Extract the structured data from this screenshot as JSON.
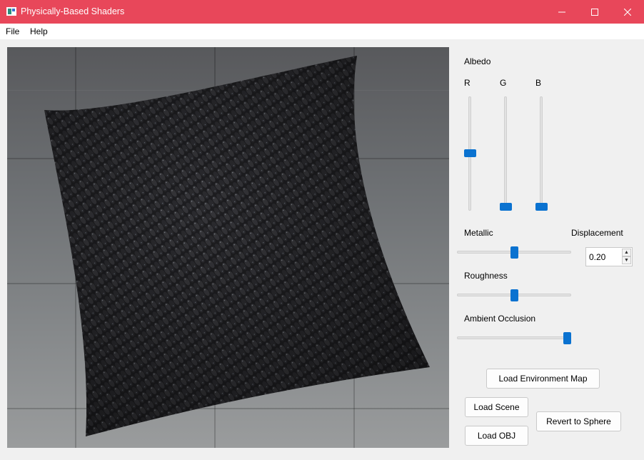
{
  "window": {
    "title": "Physically-Based Shaders",
    "minimize_glyph": "—",
    "maximize_glyph": "☐",
    "close_glyph": "✕",
    "accent_color": "#e8475a"
  },
  "menu": {
    "items": [
      "File",
      "Help"
    ]
  },
  "viewport": {
    "subject": "rendered pillow mesh on environment map background"
  },
  "controls": {
    "albedo": {
      "label": "Albedo",
      "channels": [
        {
          "label": "R",
          "level": 0.51
        },
        {
          "label": "G",
          "level": 0.0
        },
        {
          "label": "B",
          "level": 0.0
        }
      ]
    },
    "metallic": {
      "label": "Metallic",
      "level": 0.5
    },
    "roughness": {
      "label": "Roughness",
      "level": 0.5
    },
    "ambient_occlusion": {
      "label": "Ambient Occlusion",
      "level": 1.0
    },
    "displacement": {
      "label": "Displacement",
      "value": "0.20",
      "up_glyph": "▲",
      "down_glyph": "▼"
    },
    "slider_color": "#0a72d0"
  },
  "buttons": {
    "load_environment_map": "Load Environment Map",
    "load_scene": "Load Scene",
    "load_obj": "Load OBJ",
    "revert_to_sphere": "Revert to Sphere"
  }
}
